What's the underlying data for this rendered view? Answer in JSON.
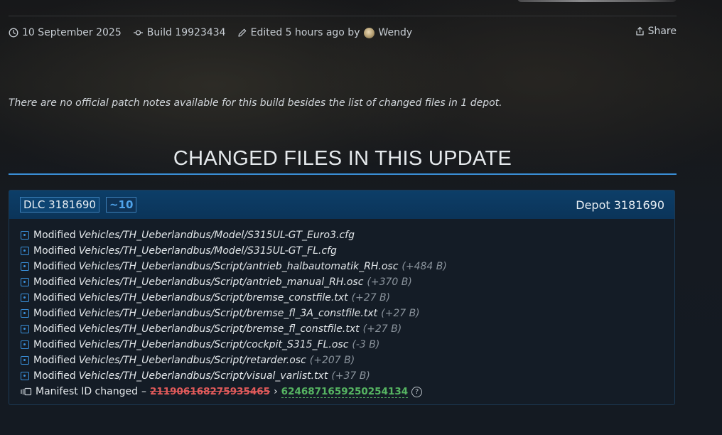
{
  "meta": {
    "date": "10 September 2025",
    "build": "Build 19923434",
    "edited": "Edited 5 hours ago by",
    "editor": "Wendy",
    "share_label": "Share"
  },
  "notice": "There are no official patch notes available for this build besides the list of changed files in 1 depot.",
  "section_title": "CHANGED FILES IN THIS UPDATE",
  "depot": {
    "dlc_label": "DLC 3181690",
    "count_label": "~10",
    "depot_label": "Depot 3181690",
    "files": [
      {
        "action": "Modified",
        "path": "Vehicles/TH_Ueberlandbus/Model/S315UL-GT_Euro3.cfg",
        "size": ""
      },
      {
        "action": "Modified",
        "path": "Vehicles/TH_Ueberlandbus/Model/S315UL-GT_FL.cfg",
        "size": ""
      },
      {
        "action": "Modified",
        "path": "Vehicles/TH_Ueberlandbus/Script/antrieb_halbautomatik_RH.osc",
        "size": "(+484 B)"
      },
      {
        "action": "Modified",
        "path": "Vehicles/TH_Ueberlandbus/Script/antrieb_manual_RH.osc",
        "size": "(+370 B)"
      },
      {
        "action": "Modified",
        "path": "Vehicles/TH_Ueberlandbus/Script/bremse_constfile.txt",
        "size": "(+27 B)"
      },
      {
        "action": "Modified",
        "path": "Vehicles/TH_Ueberlandbus/Script/bremse_fl_3A_constfile.txt",
        "size": "(+27 B)"
      },
      {
        "action": "Modified",
        "path": "Vehicles/TH_Ueberlandbus/Script/bremse_fl_constfile.txt",
        "size": "(+27 B)"
      },
      {
        "action": "Modified",
        "path": "Vehicles/TH_Ueberlandbus/Script/cockpit_S315_FL.osc",
        "size": "(-3 B)"
      },
      {
        "action": "Modified",
        "path": "Vehicles/TH_Ueberlandbus/Script/retarder.osc",
        "size": "(+207 B)"
      },
      {
        "action": "Modified",
        "path": "Vehicles/TH_Ueberlandbus/Script/visual_varlist.txt",
        "size": "(+37 B)"
      }
    ],
    "manifest": {
      "label": "Manifest ID changed",
      "dash": "–",
      "old_id": "211906168275935465",
      "arrow": "›",
      "new_id": "6246871659250254134",
      "help": "?"
    }
  },
  "colors": {
    "accent": "#3a8ed6",
    "removed": "#e05a5a",
    "added": "#56b562",
    "header_bg": "#0c3e68"
  },
  "icons": {
    "date": "clock-icon",
    "build": "commit-icon",
    "edited": "pencil-icon",
    "share": "share-icon",
    "file": "modified-file-icon",
    "manifest": "manifest-icon",
    "help": "help-icon"
  }
}
